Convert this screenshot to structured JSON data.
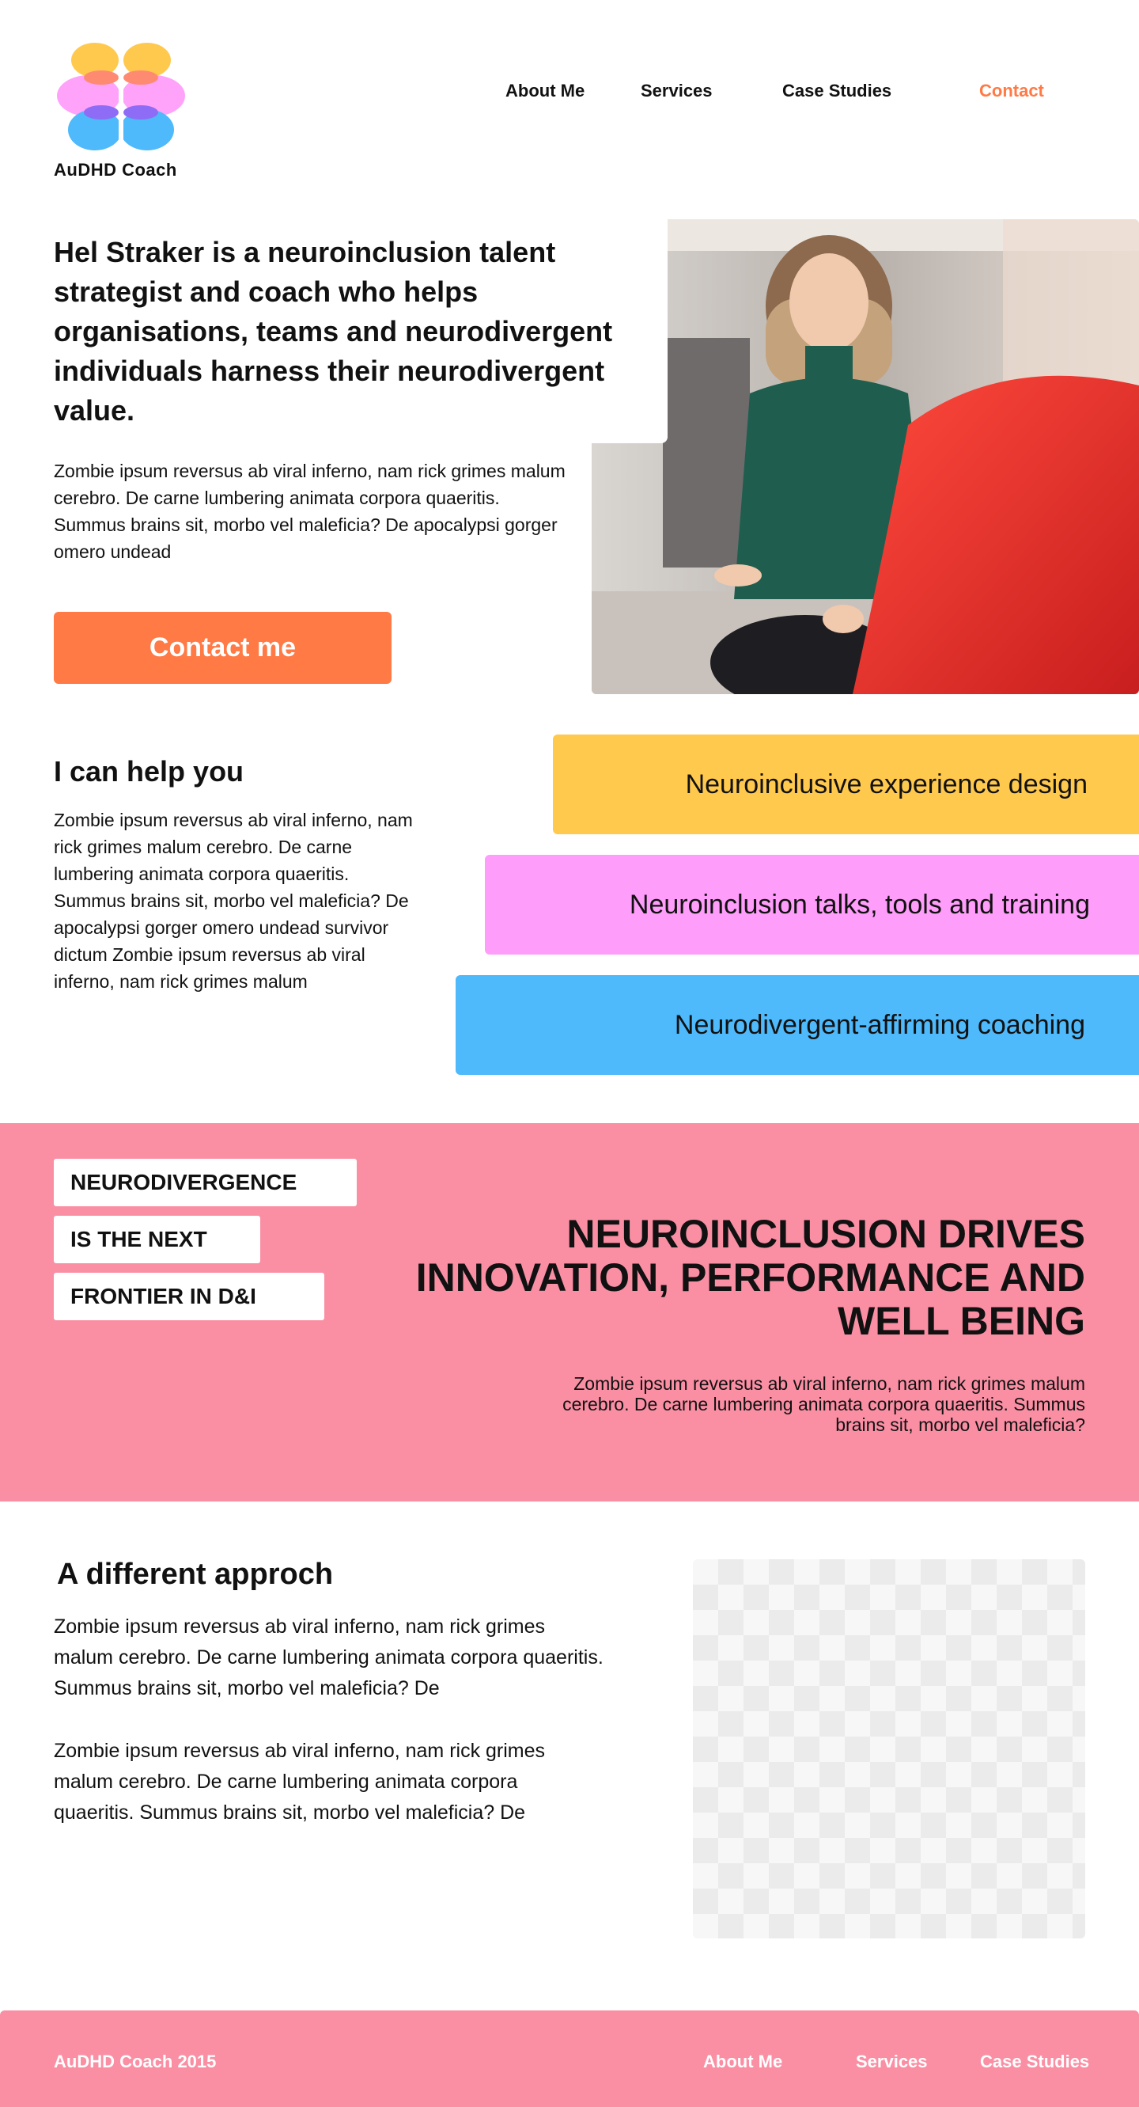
{
  "brand": {
    "name": "AuDHD  Coach",
    "colors": {
      "yellow": "#ffc94e",
      "pink": "#ff9dfa",
      "blue": "#4eb9fb",
      "orange": "#ff7a45",
      "rose": "#fa8fa4"
    }
  },
  "nav": {
    "items": [
      {
        "label": "About Me"
      },
      {
        "label": "Services"
      },
      {
        "label": "Case Studies"
      },
      {
        "label": "Contact",
        "active": true
      }
    ]
  },
  "hero": {
    "title": "Hel Straker is a neuroinclusion talent strategist and coach who helps organisations, teams and neurodivergent individuals harness their neurodivergent value.",
    "body": "Zombie ipsum reversus ab viral inferno, nam rick grimes malum cerebro. De carne lumbering animata corpora quaeritis. Summus brains sit, morbo vel maleficia? De apocalypsi gorger omero undead",
    "cta": "Contact me"
  },
  "help": {
    "title": "I can help you",
    "body": "Zombie ipsum reversus ab viral inferno, nam rick grimes malum cerebro. De carne lumbering animata corpora quaeritis. Summus brains sit, morbo vel maleficia? De apocalypsi gorger omero undead survivor dictum Zombie ipsum reversus ab viral inferno, nam rick grimes malum",
    "services": [
      "Neuroinclusive experience design",
      "Neuroinclusion talks, tools and training",
      "Neurodivergent-affirming coaching"
    ]
  },
  "band": {
    "tags": [
      "NEURODIVERGENCE",
      "IS THE NEXT",
      "FRONTIER IN D&I"
    ],
    "title": "NEUROINCLUSION DRIVES INNOVATION, PERFORMANCE AND WELL BEING",
    "body": "Zombie ipsum reversus ab viral inferno, nam rick grimes malum cerebro. De carne lumbering animata corpora quaeritis. Summus brains sit, morbo vel maleficia?"
  },
  "approach": {
    "title": "A different approch",
    "body1": "Zombie ipsum reversus ab viral inferno, nam rick grimes malum cerebro. De carne lumbering animata corpora quaeritis. Summus brains sit, morbo vel maleficia? De",
    "body2": "Zombie ipsum reversus ab viral inferno, nam rick grimes malum cerebro. De carne lumbering animata corpora quaeritis. Summus brains sit, morbo vel maleficia? De"
  },
  "footer": {
    "copyright": "AuDHD Coach 2015",
    "links": [
      "About Me",
      "Services",
      "Case Studies"
    ]
  }
}
